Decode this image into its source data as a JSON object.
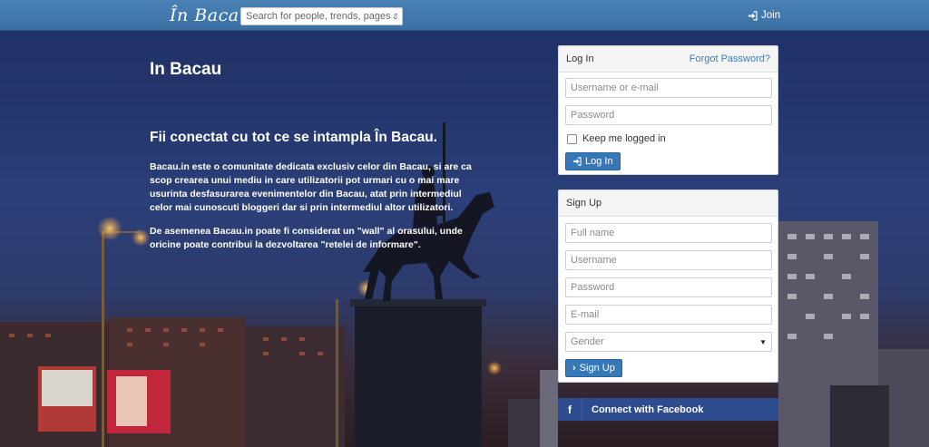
{
  "nav": {
    "brand": "În Bacau",
    "search_placeholder": "Search for people, trends, pages and...",
    "join_label": "Join"
  },
  "hero": {
    "title": "In Bacau",
    "subtitle": "Fii conectat cu tot ce se intampla În Bacau.",
    "paragraph1": "Bacau.in este o comunitate dedicata exclusiv celor din Bacau, si are ca scop crearea unui mediu in care utilizatorii pot urmari cu o mai mare usurinta desfasurarea evenimentelor din Bacau, atat prin intermediul celor mai cunoscuti bloggeri dar si prin intermediul altor utilizatori.",
    "paragraph2": "De asemenea Bacau.in poate fi considerat un \"wall\" al orasului, unde oricine poate contribui la dezvoltarea \"retelei de informare\"."
  },
  "login": {
    "heading": "Log In",
    "forgot_link": "Forgot Password?",
    "username_placeholder": "Username or e-mail",
    "password_placeholder": "Password",
    "remember_label": "Keep me logged in",
    "button_label": "Log In"
  },
  "signup": {
    "heading": "Sign Up",
    "fullname_placeholder": "Full name",
    "username_placeholder": "Username",
    "password_placeholder": "Password",
    "email_placeholder": "E-mail",
    "gender_selected": "Gender",
    "button_label": "Sign Up"
  },
  "facebook": {
    "icon_letter": "f",
    "label": "Connect with Facebook"
  },
  "colors": {
    "navbar": "#3b6fa2",
    "button": "#3677b8",
    "facebook": "#2d4b8f",
    "link": "#3b7bbf"
  }
}
